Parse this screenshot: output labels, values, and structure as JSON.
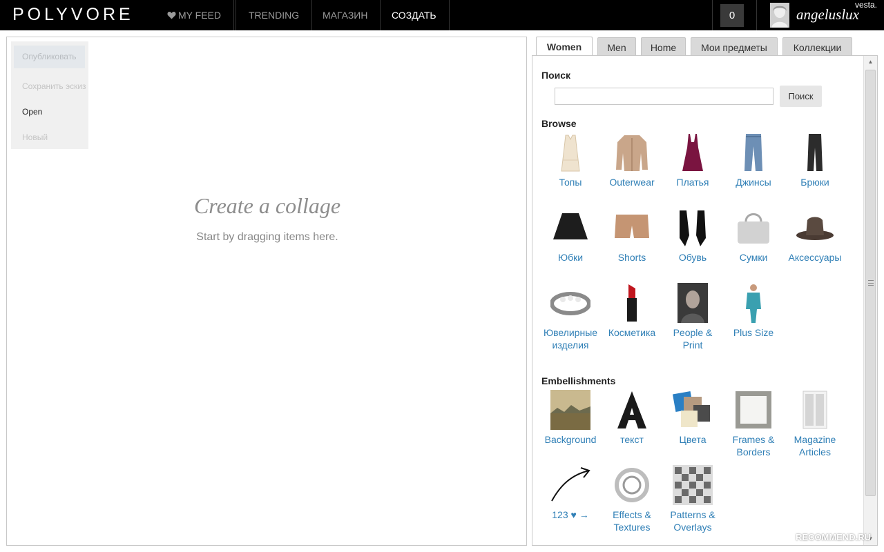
{
  "topbar": {
    "logo": "POLYVORE",
    "nav": [
      {
        "label": "MY FEED"
      },
      {
        "label": "TRENDING"
      },
      {
        "label": "МАГАЗИН"
      },
      {
        "label": "СОЗДАТЬ"
      }
    ],
    "notifications": "0",
    "username": "angeluslux",
    "brand_mark": "vesta."
  },
  "filemenu": {
    "publish": "Опубликовать",
    "save_draft": "Сохранить эскиз",
    "open": "Open",
    "new": "Новый"
  },
  "canvas": {
    "title": "Create a collage",
    "subtitle": "Start by dragging items here."
  },
  "tabs": [
    {
      "label": "Women"
    },
    {
      "label": "Men"
    },
    {
      "label": "Home"
    },
    {
      "label": "Мои предметы"
    },
    {
      "label": "Коллекции"
    }
  ],
  "search": {
    "heading": "Поиск",
    "value": "",
    "button": "Поиск"
  },
  "browse": {
    "heading": "Browse",
    "items": [
      {
        "label": "Топы",
        "icon": "top-icon"
      },
      {
        "label": "Outerwear",
        "icon": "jacket-icon"
      },
      {
        "label": "Платья",
        "icon": "dress-icon"
      },
      {
        "label": "Джинсы",
        "icon": "jeans-icon"
      },
      {
        "label": "Брюки",
        "icon": "pants-icon"
      },
      {
        "label": "Юбки",
        "icon": "skirt-icon"
      },
      {
        "label": "Shorts",
        "icon": "shorts-icon"
      },
      {
        "label": "Обувь",
        "icon": "shoes-icon"
      },
      {
        "label": "Сумки",
        "icon": "bag-icon"
      },
      {
        "label": "Аксессуары",
        "icon": "hat-icon"
      },
      {
        "label": "Ювелирные изделия",
        "icon": "bracelet-icon"
      },
      {
        "label": "Косметика",
        "icon": "lipstick-icon"
      },
      {
        "label": "People & Print",
        "icon": "portrait-icon"
      },
      {
        "label": "Plus Size",
        "icon": "swimsuit-icon"
      }
    ]
  },
  "embellishments": {
    "heading": "Embellishments",
    "items": [
      {
        "label": "Background",
        "icon": "landscape-icon"
      },
      {
        "label": "текст",
        "icon": "letter-a-icon"
      },
      {
        "label": "Цвета",
        "icon": "swatches-icon"
      },
      {
        "label": "Frames & Borders",
        "icon": "frame-icon"
      },
      {
        "label": "Magazine Articles",
        "icon": "magazine-icon"
      },
      {
        "label": "123 ♥ →",
        "icon": "arrow-icon"
      },
      {
        "label": "Effects & Textures",
        "icon": "texture-icon"
      },
      {
        "label": "Patterns & Overlays",
        "icon": "pattern-icon"
      }
    ]
  },
  "watermark": "RECOMMEND.RU",
  "colors": {
    "link": "#2f7fb6",
    "topbar": "#000000",
    "nav_inactive": "#9a9a9a"
  }
}
